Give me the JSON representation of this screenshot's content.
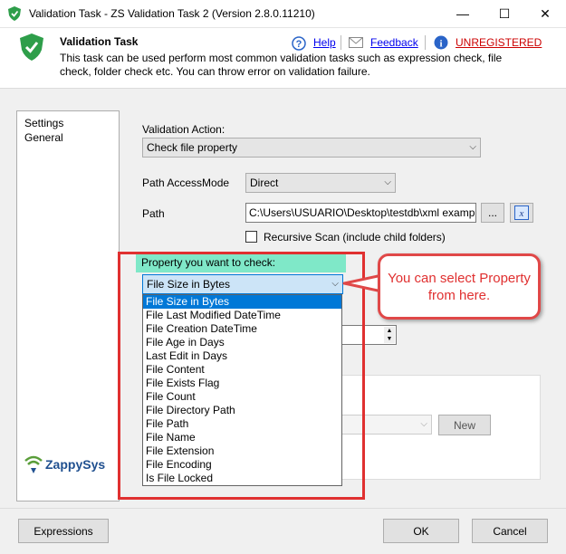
{
  "window": {
    "title": "Validation Task - ZS Validation Task 2 (Version 2.8.0.11210)",
    "minimize_glyph": "—",
    "maximize_glyph": "☐",
    "close_glyph": "✕"
  },
  "header": {
    "task_name": "Validation Task",
    "description": "This task can be used perform most common validation tasks such as expression check, file check, folder check etc. You can throw error on validation failure.",
    "help_label": "Help",
    "feedback_label": "Feedback",
    "unregistered_label": "UNREGISTERED"
  },
  "nav": {
    "items": [
      "Settings",
      "General"
    ]
  },
  "form": {
    "validation_action_label": "Validation Action:",
    "validation_action_value": "Check file property",
    "path_accessmode_label": "Path AccessMode",
    "path_accessmode_value": "Direct",
    "path_label": "Path",
    "path_value": "C:\\Users\\USUARIO\\Desktop\\testdb\\xml exampl",
    "browse_label": "...",
    "recursive_label": "Recursive Scan (include child folders)",
    "property_label": "Property you want to check:",
    "property_value": "File Size in Bytes",
    "new_button_label": "New"
  },
  "dropdown": {
    "options": [
      "File Size in Bytes",
      "File Last Modified DateTime",
      "File Creation DateTime",
      "File Age in Days",
      "Last Edit in Days",
      "File Content",
      "File Exists Flag",
      "File Count",
      "File Directory Path",
      "File Path",
      "File Name",
      "File Extension",
      "File Encoding",
      "Is File Locked"
    ],
    "selected_index": 0
  },
  "callout": {
    "text": "You can select Property from here."
  },
  "brand": {
    "logo_text": "ZappySys"
  },
  "footer": {
    "expressions_label": "Expressions",
    "ok_label": "OK",
    "cancel_label": "Cancel"
  },
  "colors": {
    "accent_red": "#e03030",
    "highlight_green": "#7fe8c8",
    "selection_blue": "#0078d7",
    "shield_green": "#2e9e4a"
  }
}
